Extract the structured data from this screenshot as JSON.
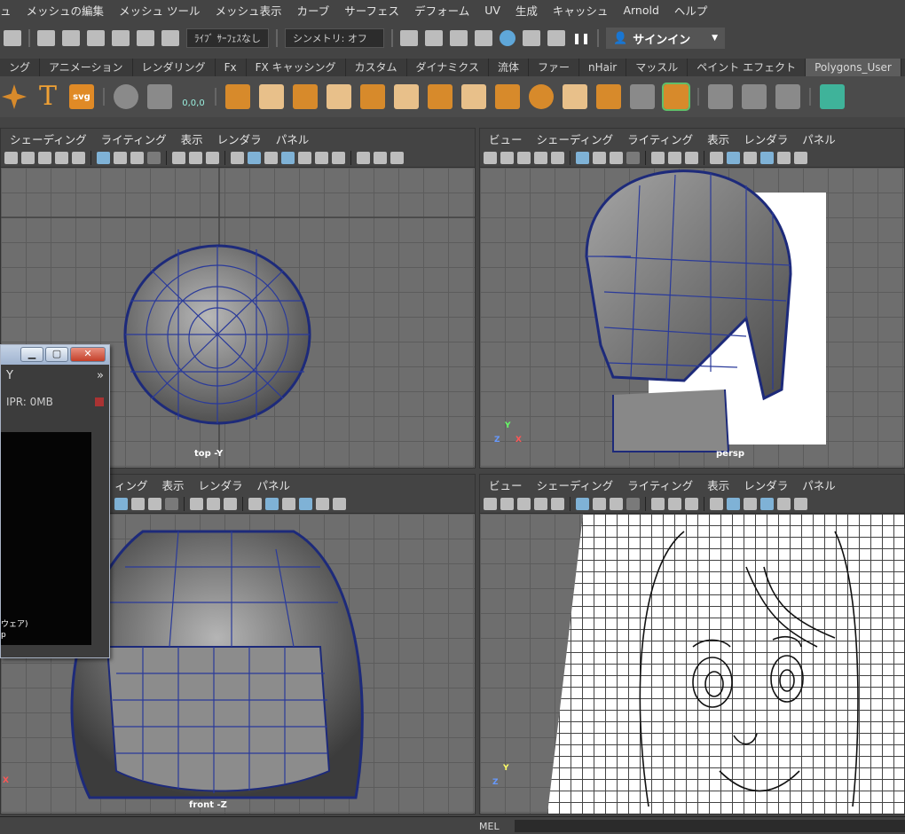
{
  "menubar": [
    "ュ",
    "メッシュの編集",
    "メッシュ ツール",
    "メッシュ表示",
    "カーブ",
    "サーフェス",
    "デフォーム",
    "UV",
    "生成",
    "キャッシュ",
    "Arnold",
    "ヘルプ"
  ],
  "status": {
    "live_surface": "ﾗｲﾌﾞ ｻｰﾌｪｽなし",
    "symmetry": "シンメトリ: オフ",
    "signin": "サインイン"
  },
  "shelf_tabs": [
    "ング",
    "アニメーション",
    "レンダリング",
    "Fx",
    "FX キャッシング",
    "カスタム",
    "ダイナミクス",
    "流体",
    "ファー",
    "nHair",
    "マッスル",
    "ペイント エフェクト",
    "Polygons_User"
  ],
  "shelf": {
    "text_tool": "T",
    "svg_tool": "svg",
    "snap_readout": "0,0,0"
  },
  "panels": {
    "top_left": {
      "menu": [
        "シェーディング",
        "ライティング",
        "表示",
        "レンダラ",
        "パネル"
      ],
      "camera": "top -Y"
    },
    "top_right": {
      "menu": [
        "ビュー",
        "シェーディング",
        "ライティング",
        "表示",
        "レンダラ",
        "パネル"
      ],
      "camera": "persp"
    },
    "bottom_left": {
      "menu": [
        "ィング",
        "表示",
        "レンダラ",
        "パネル"
      ],
      "camera": "front -Z"
    },
    "bottom_right": {
      "menu": [
        "ビュー",
        "シェーディング",
        "ライティング",
        "表示",
        "レンダラ",
        "パネル"
      ]
    }
  },
  "render_window": {
    "title_fragment": "Y",
    "ipr": "IPR: 0MB",
    "expand": "»",
    "line1": "ウェア)",
    "line2": "p"
  },
  "axes": {
    "y": "Y",
    "z": "Z",
    "x": "X"
  },
  "cmdline": {
    "label": "MEL"
  }
}
